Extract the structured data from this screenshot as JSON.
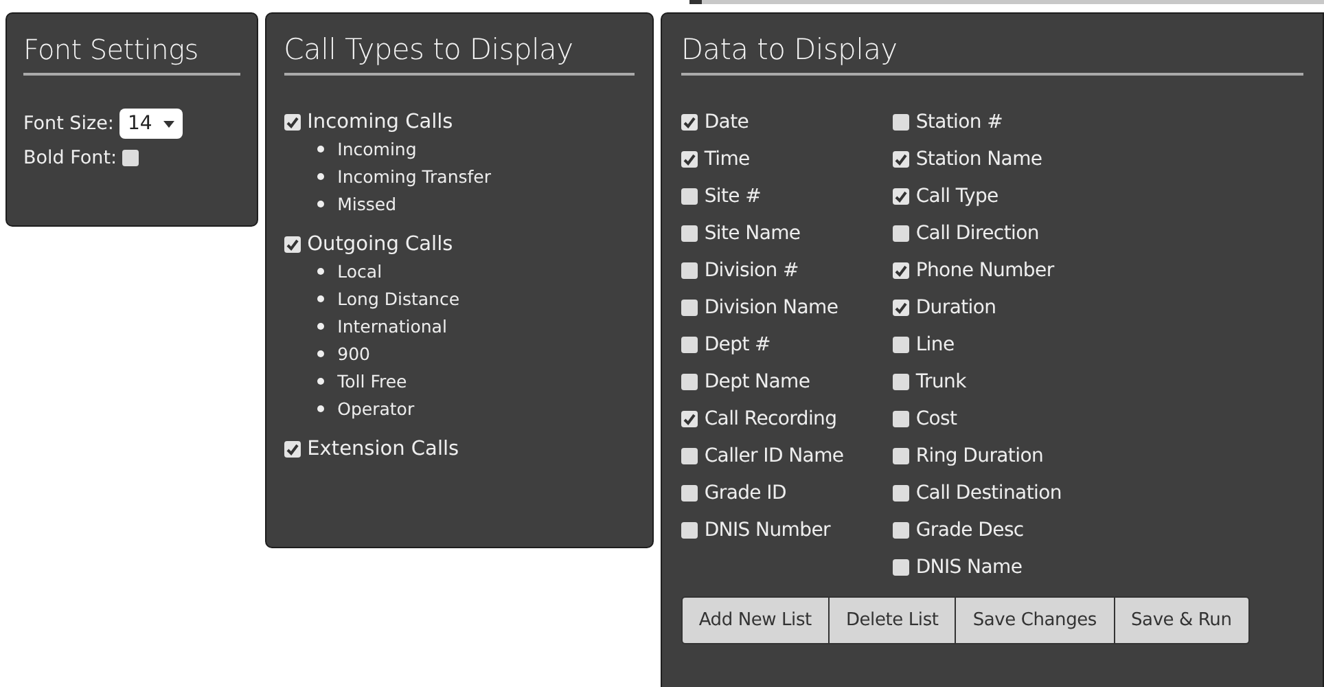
{
  "font_settings": {
    "title": "Font Settings",
    "font_size": {
      "label": "Font Size:",
      "value": "14"
    },
    "bold_font": {
      "label": "Bold Font:",
      "checked": false
    }
  },
  "call_types": {
    "title": "Call Types to Display",
    "groups": [
      {
        "label": "Incoming Calls",
        "checked": true,
        "items": [
          "Incoming",
          "Incoming Transfer",
          "Missed"
        ]
      },
      {
        "label": "Outgoing Calls",
        "checked": true,
        "items": [
          "Local",
          "Long Distance",
          "International",
          "900",
          "Toll Free",
          "Operator"
        ]
      },
      {
        "label": "Extension Calls",
        "checked": true
      }
    ]
  },
  "data_to_display": {
    "title": "Data to Display",
    "columns": [
      [
        {
          "label": "Date",
          "checked": true
        },
        {
          "label": "Time",
          "checked": true
        },
        {
          "label": "Site #",
          "checked": false
        },
        {
          "label": "Site Name",
          "checked": false
        },
        {
          "label": "Division #",
          "checked": false
        },
        {
          "label": "Division Name",
          "checked": false
        },
        {
          "label": "Dept #",
          "checked": false
        },
        {
          "label": "Dept Name",
          "checked": false
        },
        {
          "label": "Call Recording",
          "checked": true
        },
        {
          "label": "Caller ID Name",
          "checked": false
        },
        {
          "label": "Grade ID",
          "checked": false
        },
        {
          "label": "DNIS Number",
          "checked": false
        }
      ],
      [
        {
          "label": "Station #",
          "checked": false
        },
        {
          "label": "Station Name",
          "checked": true
        },
        {
          "label": "Call Type",
          "checked": true
        },
        {
          "label": "Call Direction",
          "checked": false
        },
        {
          "label": "Phone Number",
          "checked": true
        },
        {
          "label": "Duration",
          "checked": true
        },
        {
          "label": "Line",
          "checked": false
        },
        {
          "label": "Trunk",
          "checked": false
        },
        {
          "label": "Cost",
          "checked": false
        },
        {
          "label": "Ring Duration",
          "checked": false
        },
        {
          "label": "Call Destination",
          "checked": false
        },
        {
          "label": "Grade Desc",
          "checked": false
        },
        {
          "label": "DNIS Name",
          "checked": false
        }
      ]
    ]
  },
  "buttons": [
    "Add New List",
    "Delete List",
    "Save Changes",
    "Save & Run"
  ]
}
